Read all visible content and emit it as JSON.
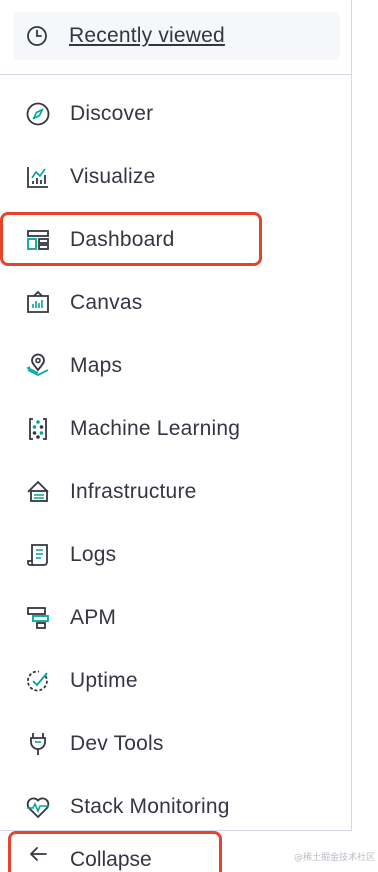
{
  "recently_viewed": {
    "label": "Recently viewed",
    "icon": "clock-icon"
  },
  "nav": {
    "items": [
      {
        "label": "Discover",
        "icon": "compass-icon"
      },
      {
        "label": "Visualize",
        "icon": "visualize-chart-icon"
      },
      {
        "label": "Dashboard",
        "icon": "dashboard-icon",
        "highlighted": true
      },
      {
        "label": "Canvas",
        "icon": "canvas-icon"
      },
      {
        "label": "Maps",
        "icon": "maps-pin-icon"
      },
      {
        "label": "Machine Learning",
        "icon": "machine-learning-icon"
      },
      {
        "label": "Infrastructure",
        "icon": "infrastructure-icon"
      },
      {
        "label": "Logs",
        "icon": "logs-icon"
      },
      {
        "label": "APM",
        "icon": "apm-icon"
      },
      {
        "label": "Uptime",
        "icon": "uptime-icon"
      },
      {
        "label": "Dev Tools",
        "icon": "dev-tools-icon"
      },
      {
        "label": "Stack Monitoring",
        "icon": "stack-monitoring-icon"
      }
    ]
  },
  "collapse": {
    "label": "Collapse",
    "icon": "arrow-left-icon",
    "highlighted": true
  },
  "watermark": "@稀土掘金技术社区",
  "colors": {
    "text": "#343741",
    "icon_dark": "#343741",
    "icon_accent": "#00a69b",
    "highlight": "#e7442f",
    "border": "#d3dae6",
    "recent_bg": "#f5f7fa"
  }
}
